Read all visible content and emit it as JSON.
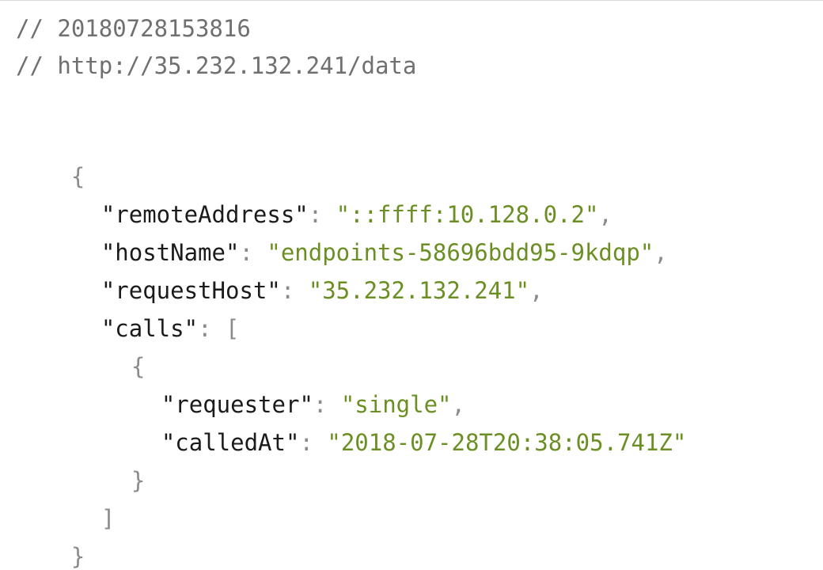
{
  "header": {
    "comment_timestamp": "// 20180728153816",
    "comment_url": "// http://35.232.132.241/data"
  },
  "json": {
    "open_brace": "{",
    "close_brace": "}",
    "fields": {
      "remoteAddress": {
        "key": "\"remoteAddress\"",
        "value": "\"::ffff:10.128.0.2\""
      },
      "hostName": {
        "key": "\"hostName\"",
        "value": "\"endpoints-58696bdd95-9kdqp\""
      },
      "requestHost": {
        "key": "\"requestHost\"",
        "value": "\"35.232.132.241\""
      },
      "calls": {
        "key": "\"calls\"",
        "open": "[",
        "close": "]"
      }
    },
    "call_item": {
      "open": "{",
      "close": "}",
      "requester": {
        "key": "\"requester\"",
        "value": "\"single\""
      },
      "calledAt": {
        "key": "\"calledAt\"",
        "value": "\"2018-07-28T20:38:05.741Z\""
      }
    },
    "punct": {
      "colon": ": ",
      "comma": ","
    }
  }
}
